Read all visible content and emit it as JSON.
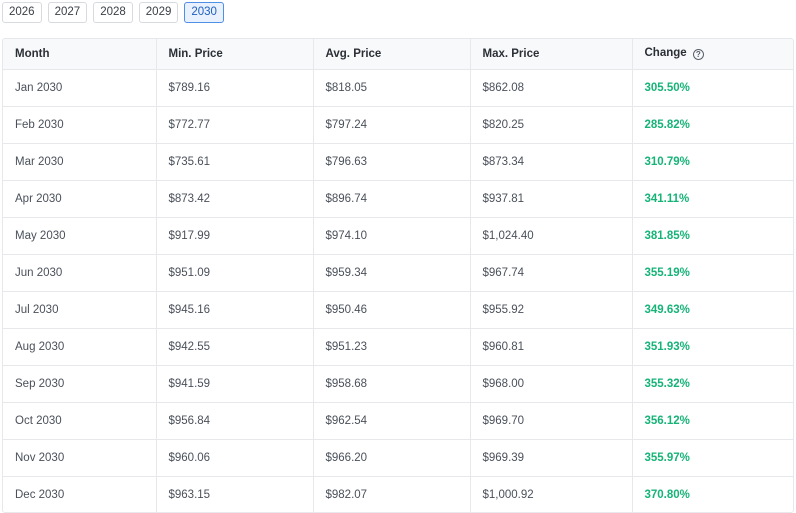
{
  "year_tabs": [
    {
      "label": "2026",
      "active": false
    },
    {
      "label": "2027",
      "active": false
    },
    {
      "label": "2028",
      "active": false
    },
    {
      "label": "2029",
      "active": false
    },
    {
      "label": "2030",
      "active": true
    }
  ],
  "table": {
    "headers": {
      "month": "Month",
      "min": "Min. Price",
      "avg": "Avg. Price",
      "max": "Max. Price",
      "change": "Change"
    },
    "help_icon": "?",
    "rows": [
      {
        "month": "Jan 2030",
        "min": "$789.16",
        "avg": "$818.05",
        "max": "$862.08",
        "change": "305.50%"
      },
      {
        "month": "Feb 2030",
        "min": "$772.77",
        "avg": "$797.24",
        "max": "$820.25",
        "change": "285.82%"
      },
      {
        "month": "Mar 2030",
        "min": "$735.61",
        "avg": "$796.63",
        "max": "$873.34",
        "change": "310.79%"
      },
      {
        "month": "Apr 2030",
        "min": "$873.42",
        "avg": "$896.74",
        "max": "$937.81",
        "change": "341.11%"
      },
      {
        "month": "May 2030",
        "min": "$917.99",
        "avg": "$974.10",
        "max": "$1,024.40",
        "change": "381.85%"
      },
      {
        "month": "Jun 2030",
        "min": "$951.09",
        "avg": "$959.34",
        "max": "$967.74",
        "change": "355.19%"
      },
      {
        "month": "Jul 2030",
        "min": "$945.16",
        "avg": "$950.46",
        "max": "$955.92",
        "change": "349.63%"
      },
      {
        "month": "Aug 2030",
        "min": "$942.55",
        "avg": "$951.23",
        "max": "$960.81",
        "change": "351.93%"
      },
      {
        "month": "Sep 2030",
        "min": "$941.59",
        "avg": "$958.68",
        "max": "$968.00",
        "change": "355.32%"
      },
      {
        "month": "Oct 2030",
        "min": "$956.84",
        "avg": "$962.54",
        "max": "$969.70",
        "change": "356.12%"
      },
      {
        "month": "Nov 2030",
        "min": "$960.06",
        "avg": "$966.20",
        "max": "$969.39",
        "change": "355.97%"
      },
      {
        "month": "Dec 2030",
        "min": "$963.15",
        "avg": "$982.07",
        "max": "$1,000.92",
        "change": "370.80%"
      }
    ]
  },
  "colors": {
    "positive_change": "#16b378",
    "active_tab_border": "#4f8fe6",
    "active_tab_bg": "#e8f1fd"
  }
}
